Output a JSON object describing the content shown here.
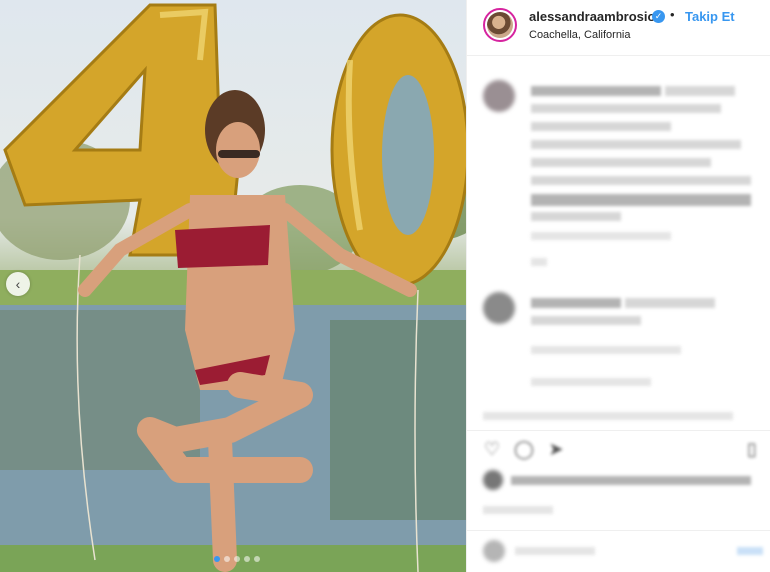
{
  "post": {
    "username": "alessandraambrosio",
    "verified_glyph": "✓",
    "separator": "•",
    "follow_label": "Takip Et",
    "location": "Coachella, California"
  },
  "carousel": {
    "prev_glyph": "‹",
    "dot_count": 5,
    "active_dot": 0
  },
  "icons": {
    "verified": "verified-badge-icon",
    "prev": "chevron-left-icon",
    "like": "heart-icon",
    "comment": "comment-icon",
    "share": "share-icon",
    "save": "bookmark-icon"
  },
  "colors": {
    "accent": "#3897f0",
    "text": "#262626",
    "divider": "#efefef",
    "balloon": "#d4a52a"
  },
  "action_glyphs": {
    "like": "♡",
    "comment": "◯",
    "share": "➤",
    "save": "▯"
  }
}
